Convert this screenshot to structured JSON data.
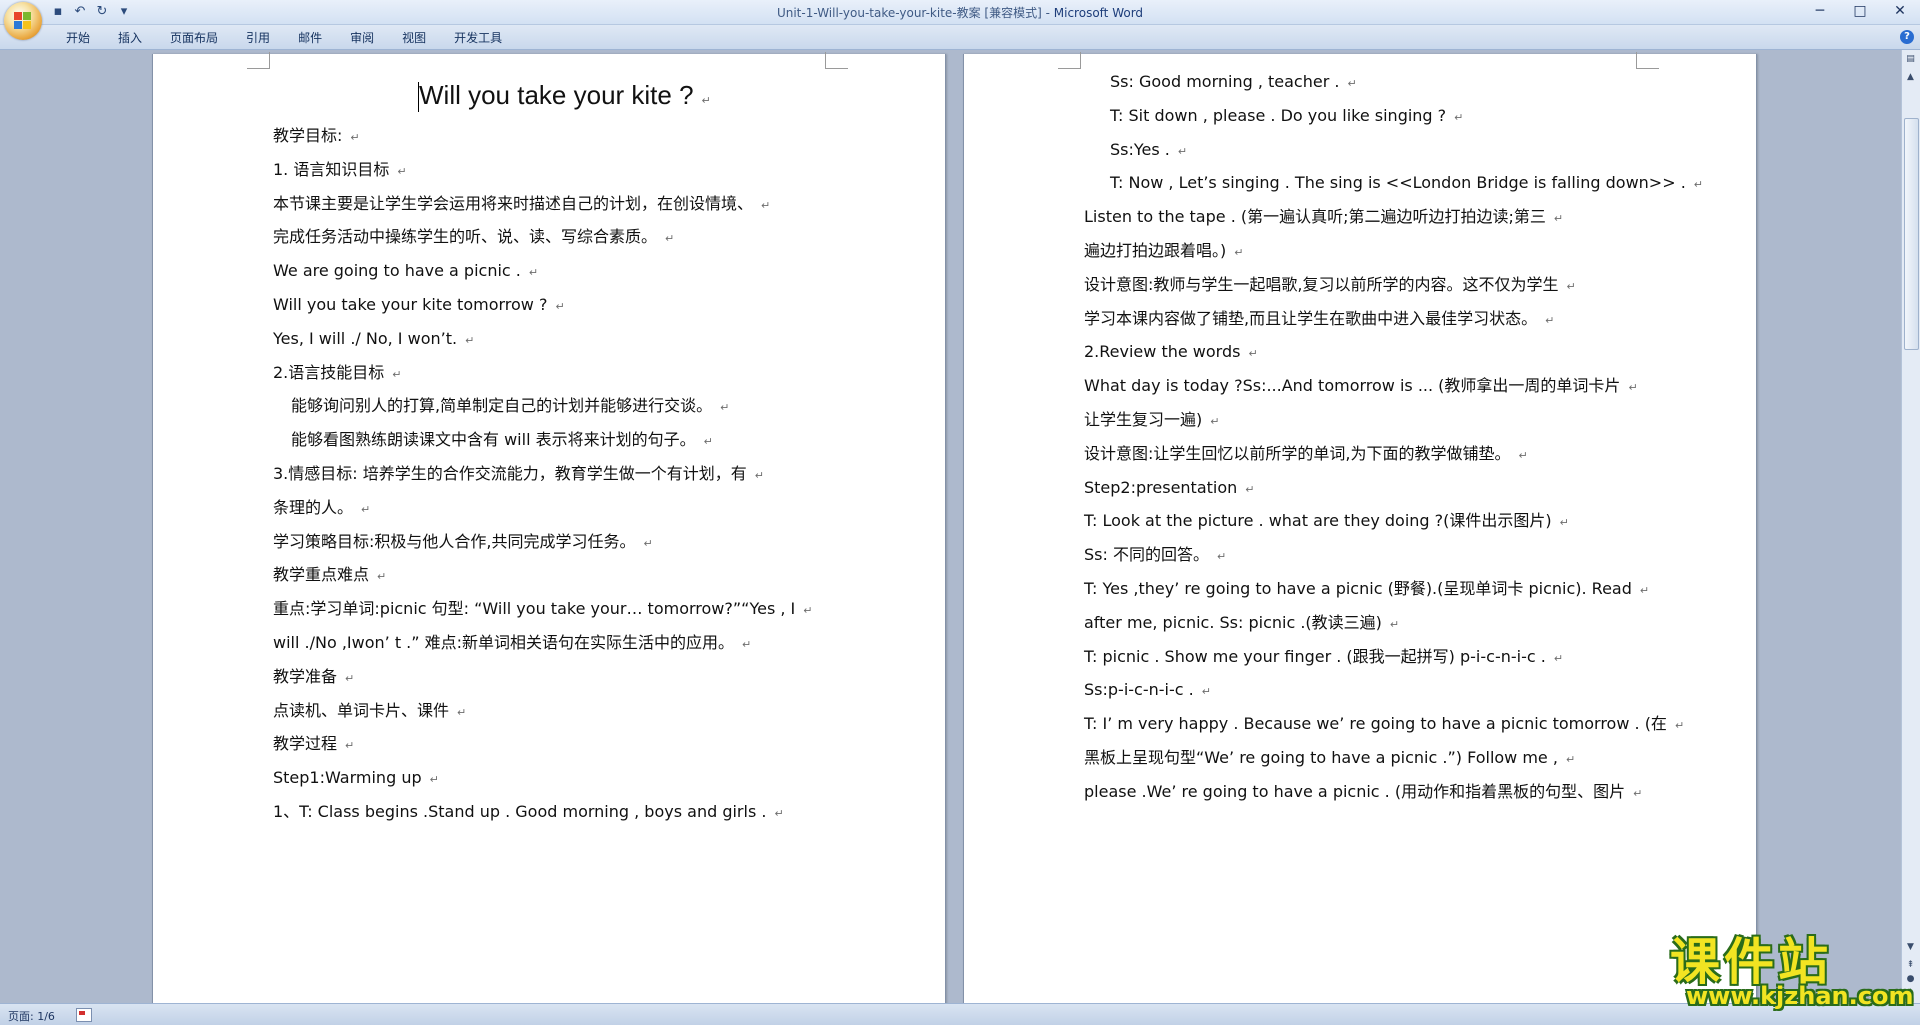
{
  "window": {
    "title": "Unit-1-Will-you-take-your-kite-教案 [兼容模式] - ",
    "app_name": "Microsoft Word",
    "minimize": "─",
    "maximize": "□",
    "close": "✕"
  },
  "ribbon": {
    "tabs": [
      "开始",
      "插入",
      "页面布局",
      "引用",
      "邮件",
      "审阅",
      "视图",
      "开发工具"
    ],
    "help": "?"
  },
  "status": {
    "page": "页面: 1/6"
  },
  "paragraph_mark": "↵",
  "doc_left": {
    "heading": "Will you take your kite ?",
    "lines": [
      "教学目标:",
      "1. 语言知识目标",
      "本节课主要是让学生学会运用将来时描述自己的计划，在创设情境、",
      "完成任务活动中操练学生的听、说、读、写综合素质。",
      "We are going to have a picnic .",
      "Will you take your kite tomorrow ?",
      "Yes, I will ./ No, I won’t.",
      "2.语言技能目标",
      "  能够询问别人的打算,简单制定自己的计划并能够进行交谈。",
      "  能够看图熟练朗读课文中含有 will 表示将来计划的句子。",
      "3.情感目标: 培养学生的合作交流能力，教育学生做一个有计划，有",
      "条理的人。",
      "学习策略目标:积极与他人合作,共同完成学习任务。",
      "教学重点难点",
      "重点:学习单词:picnic  句型: “Will you take your…  tomorrow?”“Yes , I",
      "will ./No ,Iwon’ t .”  难点:新单词相关语句在实际生活中的应用。",
      "教学准备",
      "点读机、单词卡片、课件",
      "教学过程",
      "Step1:Warming up",
      "1、T: Class begins .Stand up . Good morning , boys and girls ."
    ]
  },
  "doc_right": {
    "lines": [
      "  Ss: Good morning , teacher .",
      "  T: Sit down , please .   Do you like singing ?",
      "  Ss:Yes .",
      "  T: Now , Let’s singing . The sing is <<London Bridge is falling down>> .",
      "Listen to the tape .        (第一遍认真听;第二遍边听边打拍边读;第三",
      "遍边打拍边跟着唱。)",
      "设计意图:教师与学生一起唱歌,复习以前所学的内容。这不仅为学生",
      "学习本课内容做了铺垫,而且让学生在歌曲中进入最佳学习状态。",
      "2.Review the words",
      "What day is today ?Ss:...And tomorrow is ... (教师拿出一周的单词卡片",
      "让学生复习一遍)",
      "设计意图:让学生回忆以前所学的单词,为下面的教学做铺垫。",
      "Step2:presentation",
      "T: Look at the picture . what are they doing ?(课件出示图片)",
      "Ss: 不同的回答。",
      "T: Yes ,they’ re going to have a picnic (野餐).(呈现单词卡 picnic). Read",
      "after me, picnic.          Ss: picnic .(教读三遍)",
      "T: picnic . Show me your finger . (跟我一起拼写) p-i-c-n-i-c .",
      "Ss:p-i-c-n-i-c .",
      "T: I’ m very happy . Because we’ re going to have a picnic tomorrow . (在",
      "黑板上呈现句型“We’ re going to have a picnic .”) Follow me ,",
      "please .We’ re going to have a picnic . (用动作和指着黑板的句型、图片"
    ]
  },
  "watermark": {
    "text": "课件站",
    "url": "www.kjzhan.com"
  }
}
